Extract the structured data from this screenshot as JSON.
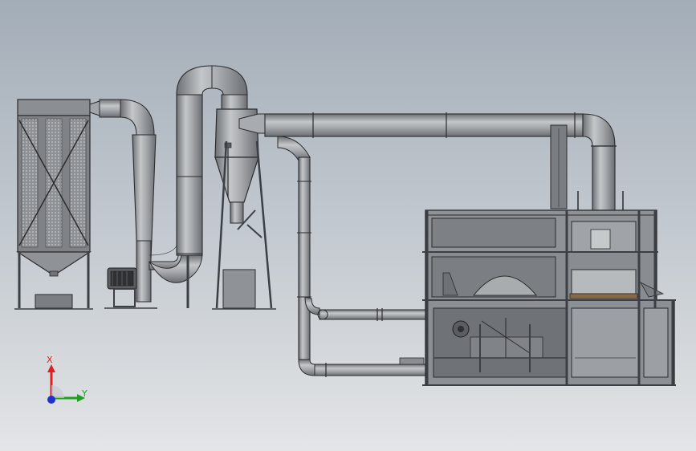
{
  "viewport": {
    "background_top": "#a3adb7",
    "background_bottom": "#e3e5e7"
  },
  "model": {
    "part_color": "#9a9da1",
    "edge_color": "#2a2c2e",
    "frame_color": "#3c4046"
  },
  "triad": {
    "x_label": "X",
    "y_label": "Y",
    "x_color": "#e02020",
    "y_color": "#20a020",
    "z_color": "#2030d0"
  }
}
